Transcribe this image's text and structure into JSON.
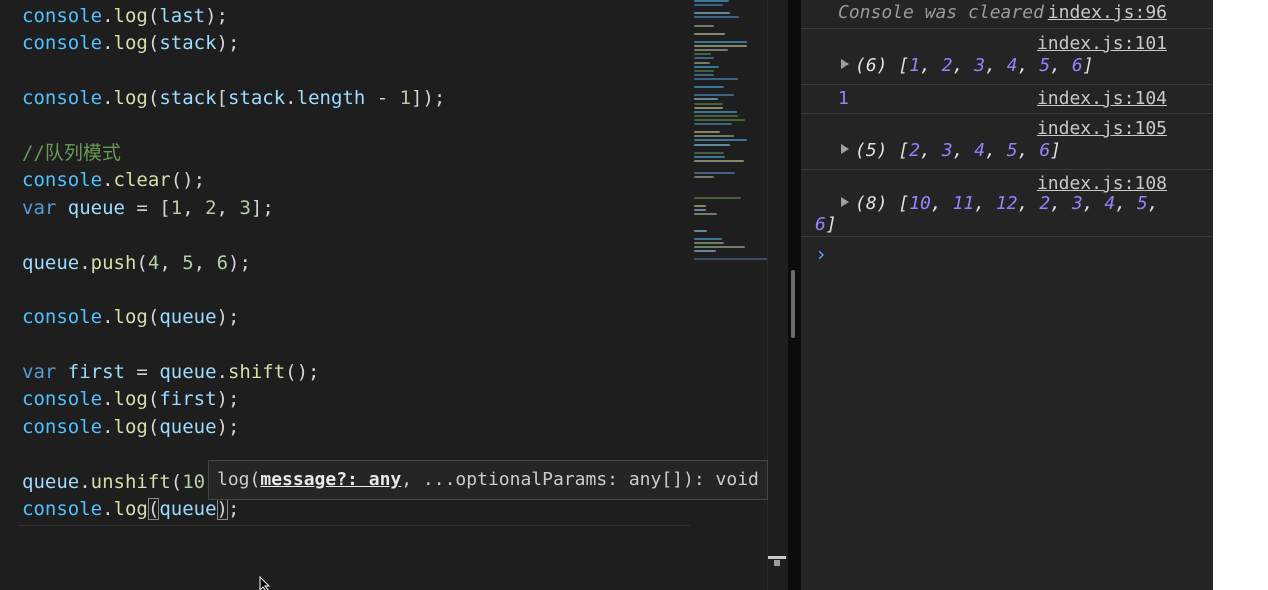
{
  "editor": {
    "lines": [
      [
        [
          "ob",
          "console"
        ],
        [
          "pn",
          "."
        ],
        [
          "mt",
          "log"
        ],
        [
          "pn",
          "("
        ],
        [
          "pr",
          "last"
        ],
        [
          "pn",
          ");"
        ]
      ],
      [
        [
          "ob",
          "console"
        ],
        [
          "pn",
          "."
        ],
        [
          "mt",
          "log"
        ],
        [
          "pn",
          "("
        ],
        [
          "pr",
          "stack"
        ],
        [
          "pn",
          ");"
        ]
      ],
      [],
      [
        [
          "ob",
          "console"
        ],
        [
          "pn",
          "."
        ],
        [
          "mt",
          "log"
        ],
        [
          "pn",
          "("
        ],
        [
          "pr",
          "stack"
        ],
        [
          "pn",
          "["
        ],
        [
          "pr",
          "stack"
        ],
        [
          "pn",
          "."
        ],
        [
          "pr",
          "length"
        ],
        [
          "pn",
          " - "
        ],
        [
          "nm",
          "1"
        ],
        [
          "pn",
          "]);"
        ]
      ],
      [],
      [
        [
          "cm",
          "//队列模式"
        ]
      ],
      [
        [
          "ob",
          "console"
        ],
        [
          "pn",
          "."
        ],
        [
          "mt",
          "clear"
        ],
        [
          "pn",
          "();"
        ]
      ],
      [
        [
          "kw",
          "var"
        ],
        [
          "pn",
          " "
        ],
        [
          "pr",
          "queue"
        ],
        [
          "pn",
          " = ["
        ],
        [
          "nm",
          "1"
        ],
        [
          "pn",
          ", "
        ],
        [
          "nm",
          "2"
        ],
        [
          "pn",
          ", "
        ],
        [
          "nm",
          "3"
        ],
        [
          "pn",
          "];"
        ]
      ],
      [],
      [
        [
          "pr",
          "queue"
        ],
        [
          "pn",
          "."
        ],
        [
          "mt",
          "push"
        ],
        [
          "pn",
          "("
        ],
        [
          "nm",
          "4"
        ],
        [
          "pn",
          ", "
        ],
        [
          "nm",
          "5"
        ],
        [
          "pn",
          ", "
        ],
        [
          "nm",
          "6"
        ],
        [
          "pn",
          ");"
        ]
      ],
      [],
      [
        [
          "ob",
          "console"
        ],
        [
          "pn",
          "."
        ],
        [
          "mt",
          "log"
        ],
        [
          "pn",
          "("
        ],
        [
          "pr",
          "queue"
        ],
        [
          "pn",
          ");"
        ]
      ],
      [],
      [
        [
          "kw",
          "var"
        ],
        [
          "pn",
          " "
        ],
        [
          "pr",
          "first"
        ],
        [
          "pn",
          " = "
        ],
        [
          "pr",
          "queue"
        ],
        [
          "pn",
          "."
        ],
        [
          "mt",
          "shift"
        ],
        [
          "pn",
          "();"
        ]
      ],
      [
        [
          "ob",
          "console"
        ],
        [
          "pn",
          "."
        ],
        [
          "mt",
          "log"
        ],
        [
          "pn",
          "("
        ],
        [
          "pr",
          "first"
        ],
        [
          "pn",
          ");"
        ]
      ],
      [
        [
          "ob",
          "console"
        ],
        [
          "pn",
          "."
        ],
        [
          "mt",
          "log"
        ],
        [
          "pn",
          "("
        ],
        [
          "pr",
          "queue"
        ],
        [
          "pn",
          ");"
        ]
      ],
      [],
      [
        [
          "pr",
          "queue"
        ],
        [
          "pn",
          "."
        ],
        [
          "mt",
          "unshift"
        ],
        [
          "pn",
          "("
        ],
        [
          "nm",
          "10"
        ],
        [
          "pn",
          ","
        ]
      ],
      [
        [
          "ob",
          "console"
        ],
        [
          "pn",
          "."
        ],
        [
          "mt",
          "log"
        ],
        [
          "pn",
          "("
        ],
        [
          "pr",
          "queue"
        ],
        [
          "pn",
          ");"
        ]
      ]
    ],
    "signature_hint": {
      "prefix": "log(",
      "active_param": "message?: any",
      "rest": ", ...optionalParams: any[]): void"
    }
  },
  "console": {
    "cleared_text": "Console was cleared",
    "cleared_source": "index.js:96",
    "entries": [
      {
        "source": "index.js:101",
        "count": "(6)",
        "values": [
          "1",
          "2",
          "3",
          "4",
          "5",
          "6"
        ]
      },
      {
        "source": "index.js:104",
        "scalar": "1"
      },
      {
        "source": "index.js:105",
        "count": "(5)",
        "values": [
          "2",
          "3",
          "4",
          "5",
          "6"
        ]
      },
      {
        "source": "index.js:108",
        "count": "(8)",
        "values": [
          "10",
          "11",
          "12",
          "2",
          "3",
          "4",
          "5",
          "6"
        ]
      }
    ],
    "prompt_symbol": "›"
  }
}
